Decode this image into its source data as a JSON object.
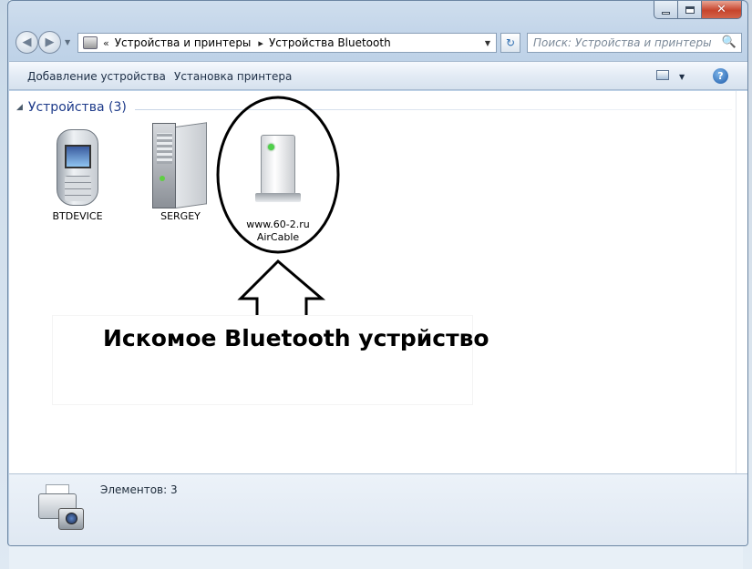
{
  "window": {
    "caption": {
      "minimize_icon": "minimize-icon",
      "maximize_icon": "maximize-icon",
      "close_icon": "close-icon",
      "close_glyph": "✕"
    }
  },
  "navigation": {
    "back_icon": "back-arrow-icon",
    "forward_icon": "forward-arrow-icon",
    "back_glyph": "◀",
    "forward_glyph": "▶",
    "address": {
      "overflow_glyph": "«",
      "separator_glyph": "▸",
      "crumbs": [
        "Устройства и принтеры",
        "Устройства Bluetooth"
      ],
      "dropdown_glyph": "▼"
    },
    "refresh_glyph": "↻",
    "search": {
      "placeholder": "Поиск: Устройства и принтеры",
      "icon_glyph": "🔍"
    }
  },
  "commandbar": {
    "add_device": "Добавление устройства",
    "add_printer": "Установка принтера",
    "view_dropdown_glyph": "▼",
    "help_glyph": "?"
  },
  "content": {
    "group_title": "Устройства (3)",
    "collapse_glyph": "◢",
    "devices": [
      {
        "name": "BTDEVICE",
        "icon": "mobile-phone-icon"
      },
      {
        "name": "SERGEY",
        "icon": "computer-tower-icon"
      },
      {
        "name_line1": "www.60-2.ru",
        "name_line2": "AirCable",
        "icon": "bluetooth-device-icon"
      }
    ],
    "annotation": {
      "text": "Искомое Bluetooth устрйство",
      "highlight_color": "#000000"
    }
  },
  "details": {
    "count": "Элементов: 3",
    "icon": "devices-and-printers-icon"
  },
  "colors": {
    "group_title": "#1e3b8a",
    "close_button": "#c7442c",
    "window_frame": "#c3d5e9"
  }
}
